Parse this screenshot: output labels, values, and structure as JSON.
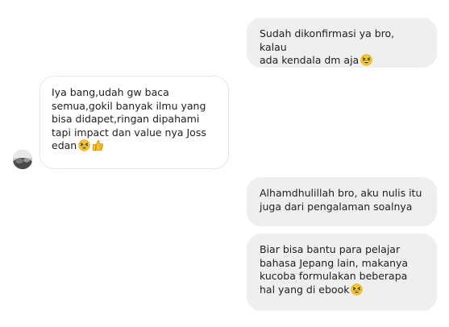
{
  "messages": [
    {
      "direction": "outgoing",
      "lines": [
        "Sudah dikonfirmasi ya bro, kalau",
        "ada kendala dm aja"
      ],
      "trailing_icons": [
        "grinning-squint-emoji"
      ]
    },
    {
      "direction": "incoming",
      "lines": [
        "Iya bang,udah gw baca",
        "semua,gokil banyak ilmu yang",
        "bisa didapet,ringan dipahami",
        "tapi impact dan value nya Joss",
        "edan"
      ],
      "trailing_icons": [
        "grinning-squint-emoji",
        "thumbs-up-emoji"
      ]
    },
    {
      "direction": "outgoing",
      "lines": [
        "Alhamdhulillah bro, aku nulis itu",
        "juga dari pengalaman soalnya"
      ],
      "trailing_icons": []
    },
    {
      "direction": "outgoing",
      "lines": [
        "Biar bisa bantu para pelajar",
        "bahasa Jepang lain, makanya",
        "kucoba formulakan beberapa",
        "hal yang di ebook"
      ],
      "trailing_icons": [
        "grinning-squint-emoji"
      ]
    }
  ],
  "colors": {
    "outgoing_bubble": "#efefef",
    "incoming_bubble": "#ffffff",
    "incoming_border": "#e4e6eb",
    "text": "#1c1e21",
    "emoji_face": "#f7c52f"
  }
}
